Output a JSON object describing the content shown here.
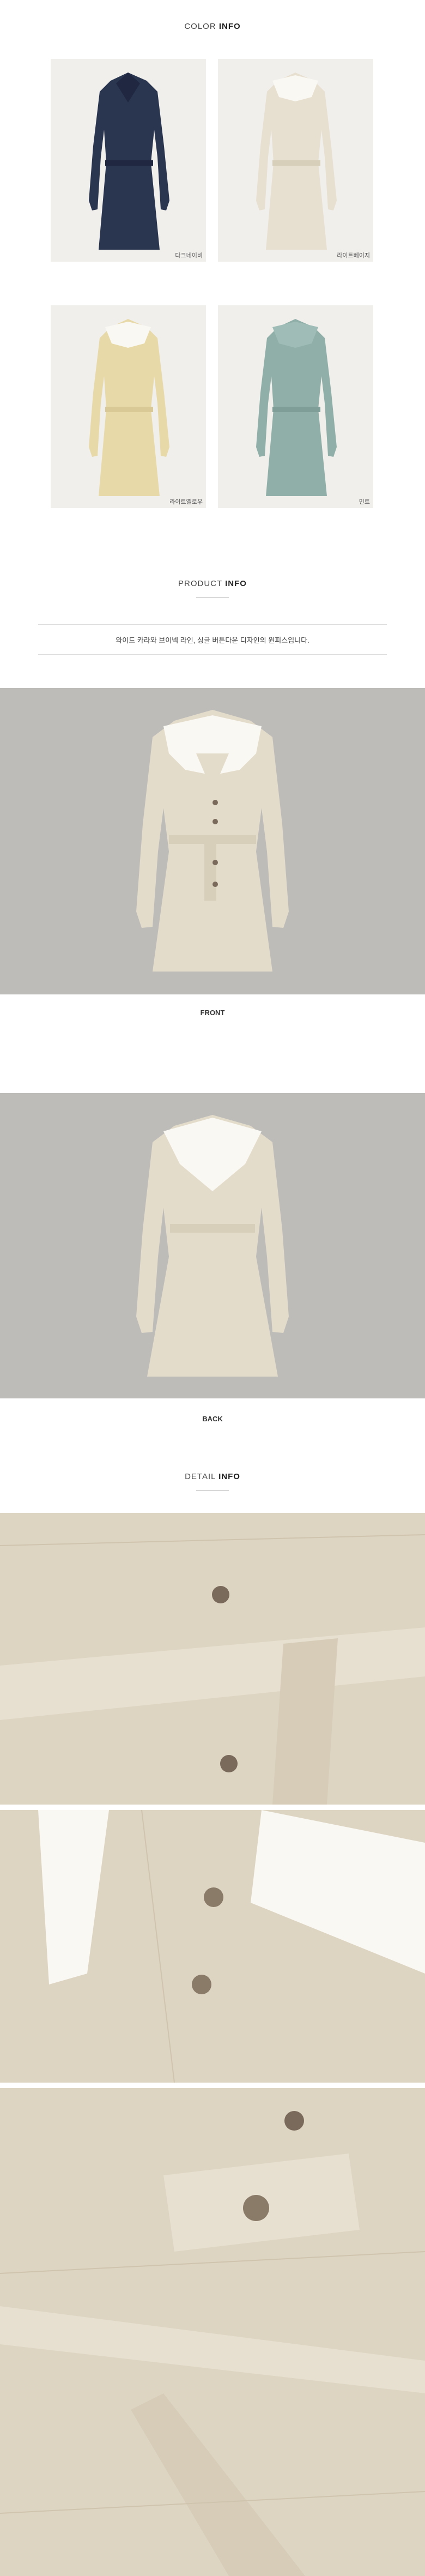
{
  "color_info": {
    "title_light": "COLOR",
    "title_bold": "INFO",
    "swatches": [
      {
        "caption": "다크네이비",
        "color": "#2a3550"
      },
      {
        "caption": "라이트베이지",
        "color": "#e7e0d0"
      },
      {
        "caption": "라이트옐로우",
        "color": "#e8d9a8"
      },
      {
        "caption": "민트",
        "color": "#8fafa8"
      }
    ]
  },
  "product_info": {
    "title_light": "PRODUCT",
    "title_bold": "INFO",
    "description": "와이드 카라와 브이넥 라인, 싱글 버튼다운 디자인의 원피스입니다."
  },
  "views": [
    {
      "label": "FRONT"
    },
    {
      "label": "BACK"
    }
  ],
  "detail_info": {
    "title_light": "DETAIL",
    "title_bold": "INFO"
  },
  "colors": {
    "beige": "#e4dccb",
    "beige_dark": "#cfc4ad",
    "collar": "#faf8f2",
    "bg_gray": "#bdbcb9",
    "button": "#7a6a5c"
  }
}
